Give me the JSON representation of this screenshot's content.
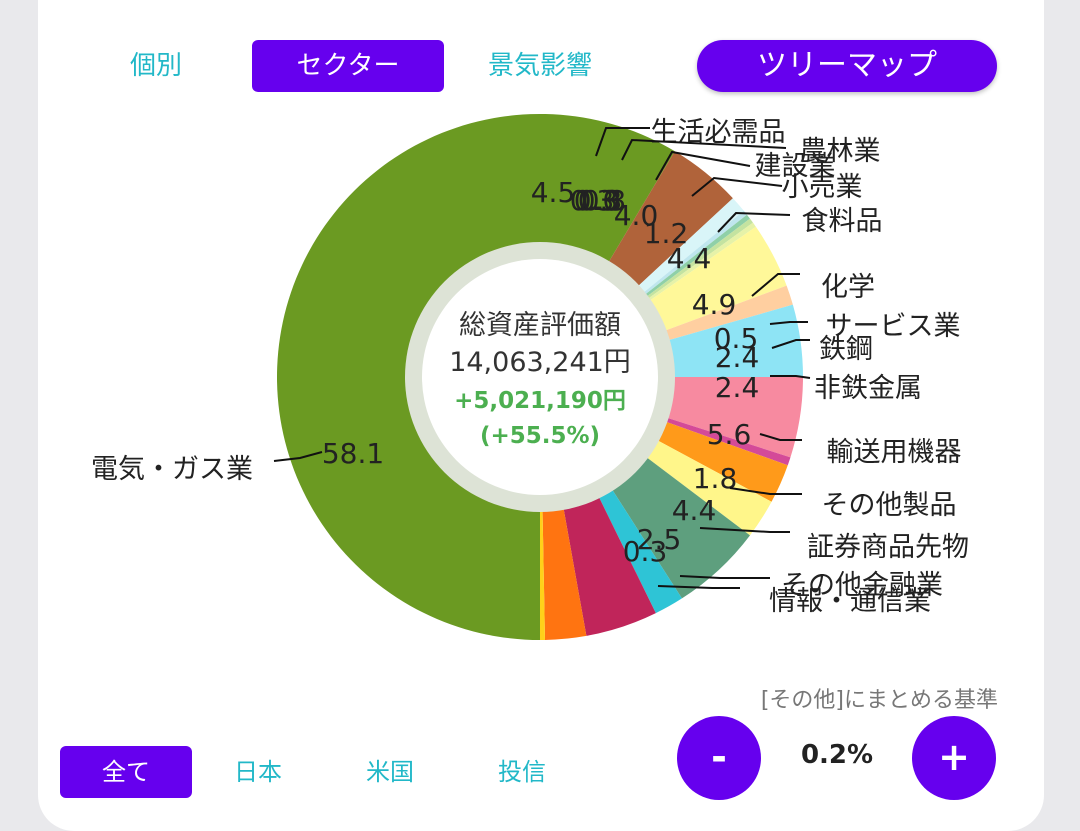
{
  "tabs": {
    "kobetsu": "個別",
    "sector": "セクター",
    "keiki": "景気影響",
    "treemap": "ツリーマップ"
  },
  "center": {
    "label": "総資産評価額",
    "total": "14,063,241円",
    "gain": "+5,021,190円",
    "gain_pct": "(+55.5%)"
  },
  "filters": {
    "all": "全て",
    "japan": "日本",
    "us": "米国",
    "fund": "投信"
  },
  "threshold": {
    "caption": "[その他]にまとめる基準",
    "value": "0.2%",
    "minus": "-",
    "plus": "+"
  },
  "chart_data": {
    "type": "pie",
    "variant": "donut",
    "labels_format": "percent of total",
    "slices": [
      {
        "name": "電気・ガス業",
        "value": 58.1,
        "color": "#6b9a22"
      },
      {
        "name": "",
        "value": 4.5,
        "color": "#b0633a"
      },
      {
        "name": "生活必需品",
        "value": 1.0,
        "color": "#d9f5f8"
      },
      {
        "name": "",
        "value": 0.3,
        "color": "#bfe6ee"
      },
      {
        "name": "",
        "value": 0.3,
        "color": "#8fd0a8"
      },
      {
        "name": "",
        "value": 0.3,
        "color": "#c4e3a0"
      },
      {
        "name": "農林業",
        "value": 0.3,
        "color": "#e6f2a8"
      },
      {
        "name": "建設業",
        "value": 4.0,
        "color": "#fff899"
      },
      {
        "name": "小売業",
        "value": 1.2,
        "color": "#ffcfa0"
      },
      {
        "name": "食料品",
        "value": 4.4,
        "color": "#8ee4f5"
      },
      {
        "name": "化学",
        "value": 4.9,
        "color": "#f78aa0"
      },
      {
        "name": "サービス業",
        "value": 0.5,
        "color": "#d44a98"
      },
      {
        "name": "鉄鋼",
        "value": 2.4,
        "color": "#ff9a1a"
      },
      {
        "name": "非鉄金属",
        "value": 2.4,
        "color": "#fff68a"
      },
      {
        "name": "輸送用機器",
        "value": 5.6,
        "color": "#5e9f7e"
      },
      {
        "name": "その他製品",
        "value": 1.8,
        "color": "#2ec4d6"
      },
      {
        "name": "証券商品先物",
        "value": 4.4,
        "color": "#c0255a"
      },
      {
        "name": "その他金融業",
        "value": 2.5,
        "color": "#ff7411"
      },
      {
        "name": "情報・通信業",
        "value": 0.3,
        "color": "#ffd11a"
      }
    ],
    "labels_as_drawn": [
      {
        "name": "電気・ガス業",
        "value": "58.1"
      },
      {
        "name": "",
        "value": "4.5"
      },
      {
        "name": "生活必需品",
        "value": "1.0"
      },
      {
        "name": "",
        "value": "0.3"
      },
      {
        "name": "",
        "value": "0.3"
      },
      {
        "name": "",
        "value": "0.3"
      },
      {
        "name": "農林業",
        "value": "0.3"
      },
      {
        "name": "建設業",
        "value": "4.0"
      },
      {
        "name": "小売業",
        "value": "1.2"
      },
      {
        "name": "食料品",
        "value": "4.4"
      },
      {
        "name": "化学",
        "value": "4.9"
      },
      {
        "name": "サービス業",
        "value": "0.5"
      },
      {
        "name": "鉄鋼",
        "value": "2.4"
      },
      {
        "name": "非鉄金属",
        "value": "2.4"
      },
      {
        "name": "輸送用機器",
        "value": "5.6"
      },
      {
        "name": "その他製品",
        "value": "1.8"
      },
      {
        "name": "証券商品先物",
        "value": "4.4"
      },
      {
        "name": "その他金融業",
        "value": "2.5"
      },
      {
        "name": "情報・通信業",
        "value": "0.3"
      }
    ]
  }
}
